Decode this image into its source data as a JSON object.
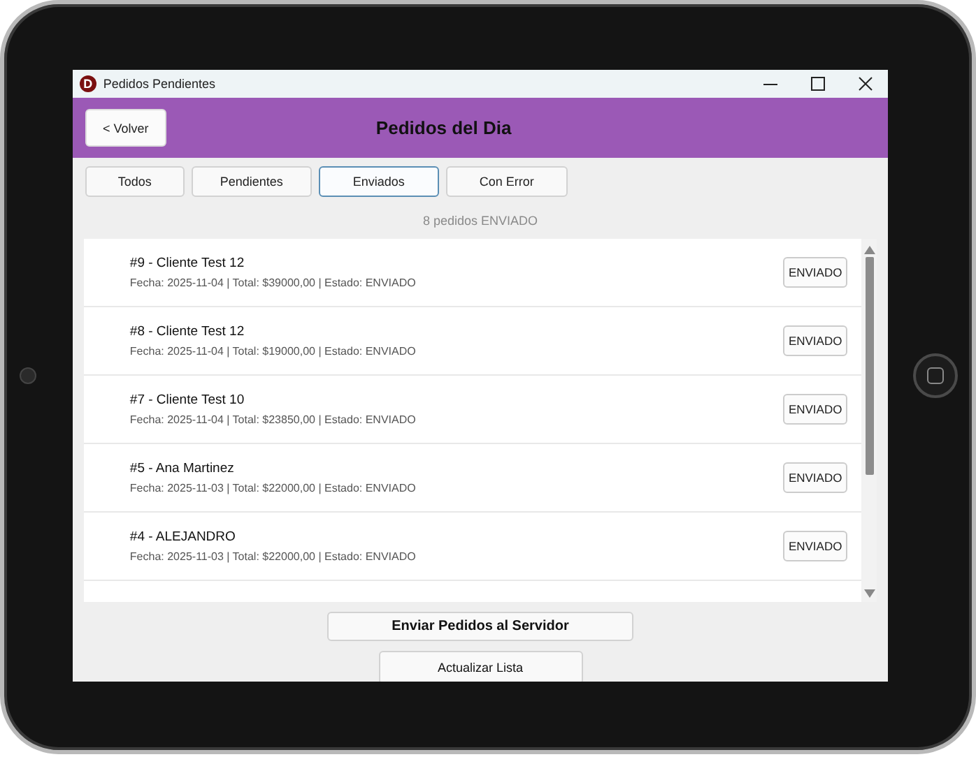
{
  "window": {
    "icon_letter": "D",
    "title": "Pedidos Pendientes"
  },
  "header": {
    "back_button": "< Volver",
    "title": "Pedidos del Dia"
  },
  "tabs": [
    {
      "label": "Todos",
      "selected": false
    },
    {
      "label": "Pendientes",
      "selected": false
    },
    {
      "label": "Enviados",
      "selected": true
    },
    {
      "label": "Con Error",
      "selected": false
    }
  ],
  "summary": "8 pedidos ENVIADO",
  "orders": [
    {
      "title": "#9 - Cliente Test 12",
      "details": "Fecha: 2025-11-04 | Total: $39000,00 | Estado: ENVIADO",
      "status": "ENVIADO"
    },
    {
      "title": "#8 - Cliente Test 12",
      "details": "Fecha: 2025-11-04 | Total: $19000,00 | Estado: ENVIADO",
      "status": "ENVIADO"
    },
    {
      "title": "#7 - Cliente Test 10",
      "details": "Fecha: 2025-11-04 | Total: $23850,00 | Estado: ENVIADO",
      "status": "ENVIADO"
    },
    {
      "title": "#5 - Ana Martinez",
      "details": "Fecha: 2025-11-03 | Total: $22000,00 | Estado: ENVIADO",
      "status": "ENVIADO"
    },
    {
      "title": "#4 - ALEJANDRO",
      "details": "Fecha: 2025-11-03 | Total: $22000,00 | Estado: ENVIADO",
      "status": "ENVIADO"
    }
  ],
  "buttons": [
    {
      "label": "Enviar Pedidos al Servidor",
      "kind": "primary"
    },
    {
      "label": "Actualizar Lista",
      "kind": "secondary"
    }
  ]
}
